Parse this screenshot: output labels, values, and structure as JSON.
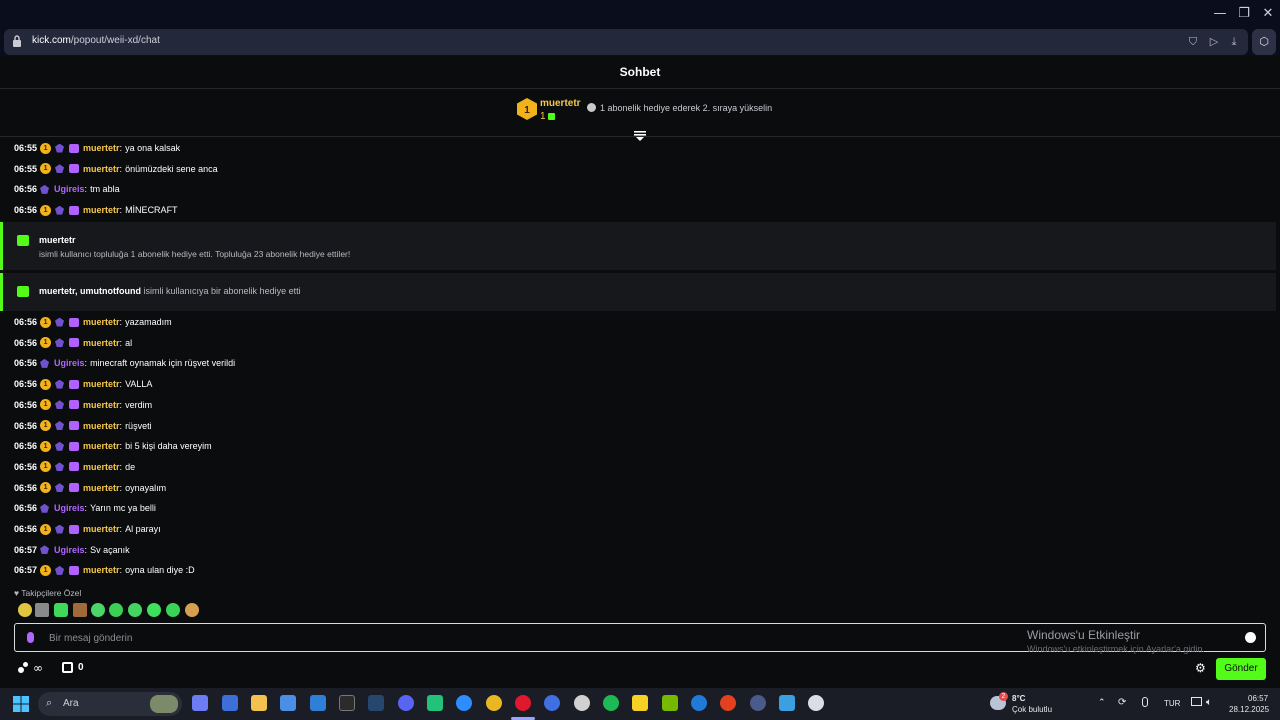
{
  "browser": {
    "url_host": "kick.com",
    "url_path": "/popout/weii-xd/chat"
  },
  "chat": {
    "title": "Sohbet",
    "pinned": {
      "username": "muertetr",
      "rank": "1",
      "gift_count": "1",
      "info": "1 abonelik hediye ederek 2. sıraya yükselin"
    },
    "messages_top": [
      {
        "time": "06:55",
        "user": "muertetr",
        "text": "ya ona kalsak",
        "type": "muer"
      },
      {
        "time": "06:55",
        "user": "muertetr",
        "text": "önümüzdeki sene anca",
        "type": "muer"
      },
      {
        "time": "06:56",
        "user": "Ugireis",
        "text": "tm abla",
        "type": "ugi"
      },
      {
        "time": "06:56",
        "user": "muertetr",
        "text": "MİNECRAFT",
        "type": "muer"
      }
    ],
    "gift_event_1": {
      "title": "muertetr",
      "subtitle": "isimli kullanıcı topluluğa 1 abonelik hediye etti. Topluluğa 23 abonelik hediye ettiler!"
    },
    "gift_event_2": {
      "users": "muertetr, umutnotfound",
      "text": "isimli kullanıcıya bir abonelik hediye etti"
    },
    "messages_bottom": [
      {
        "time": "06:56",
        "user": "muertetr",
        "text": "yazamadım",
        "type": "muer"
      },
      {
        "time": "06:56",
        "user": "muertetr",
        "text": "al",
        "type": "muer"
      },
      {
        "time": "06:56",
        "user": "Ugireis",
        "text": "minecraft oynamak için rüşvet verildi",
        "type": "ugi"
      },
      {
        "time": "06:56",
        "user": "muertetr",
        "text": "VALLA",
        "type": "muer"
      },
      {
        "time": "06:56",
        "user": "muertetr",
        "text": "verdim",
        "type": "muer"
      },
      {
        "time": "06:56",
        "user": "muertetr",
        "text": "rüşveti",
        "type": "muer"
      },
      {
        "time": "06:56",
        "user": "muertetr",
        "text": "bi 5 kişi daha vereyim",
        "type": "muer"
      },
      {
        "time": "06:56",
        "user": "muertetr",
        "text": "de",
        "type": "muer"
      },
      {
        "time": "06:56",
        "user": "muertetr",
        "text": "oynayalım",
        "type": "muer"
      },
      {
        "time": "06:56",
        "user": "Ugireis",
        "text": "Yarın mc ya belli",
        "type": "ugi"
      },
      {
        "time": "06:56",
        "user": "muertetr",
        "text": "Al parayı",
        "type": "muer"
      },
      {
        "time": "06:57",
        "user": "Ugireis",
        "text": "Sv açanık",
        "type": "ugi"
      },
      {
        "time": "06:57",
        "user": "muertetr",
        "text": "oyna ulan diye :D",
        "type": "muer"
      }
    ],
    "favorites_label": "Takipçilere Özel",
    "input_placeholder": "Bir mesaj gönderin",
    "watermark_title": "Windows'u Etkinleştir",
    "watermark_sub": "Windows'u etkinleştirmek için Ayarlar'a gidin.",
    "points_value": "∞",
    "gift_value": "0",
    "send_label": "Gönder",
    "badge_number": "1",
    "username_sep": ":"
  },
  "taskbar": {
    "search_placeholder": "Ara",
    "weather_temp": "8°C",
    "weather_desc": "Çok bulutlu",
    "weather_badge": "2",
    "lang": "TUR",
    "time": "06:57",
    "date": "28.12.2025"
  },
  "colors": {
    "accent": "#53fc18",
    "muertetr": "#f5c84a",
    "ugireis": "#b066ff"
  }
}
